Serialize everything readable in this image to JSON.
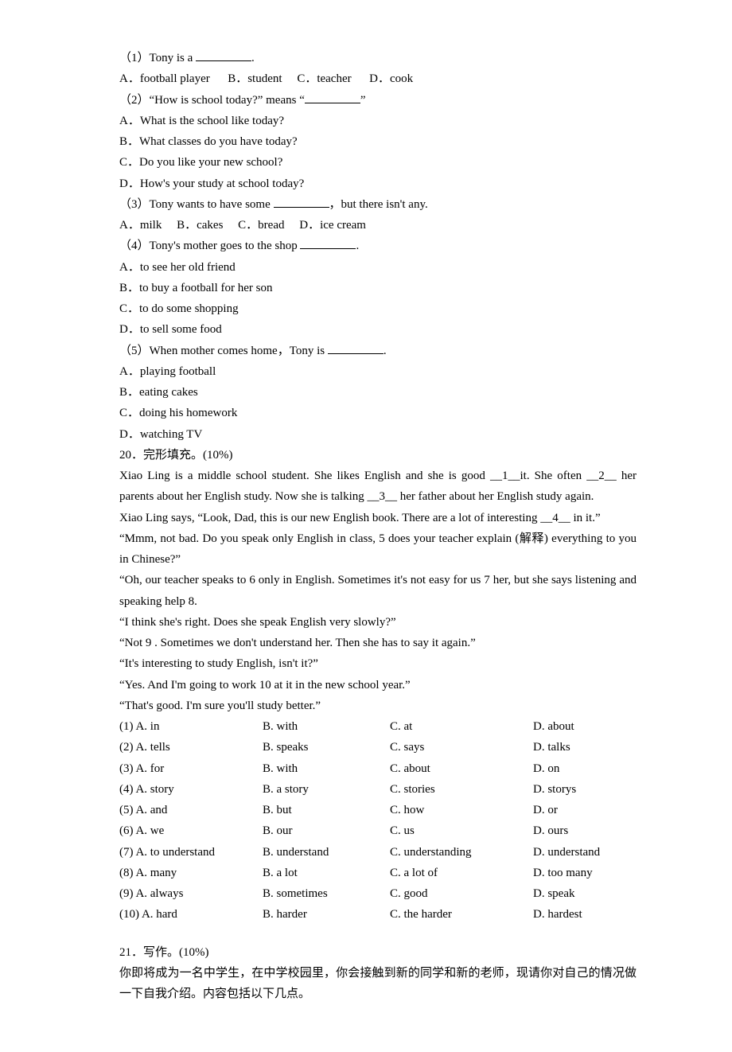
{
  "q19": {
    "q1": {
      "stem_pre": "（1）Tony is a ",
      "stem_post": "."
    },
    "q1opts": {
      "a": "A．football player",
      "b": "B．student",
      "c": "C．teacher",
      "d": "D．cook"
    },
    "q2": {
      "stem_pre": "（2）“How is school today?” means “",
      "stem_post": "”"
    },
    "q2opts": {
      "a": "A．What is the school like today?",
      "b": "B．What classes do you have today?",
      "c": "C．Do you like your new school?",
      "d": "D．How's your study at school today?"
    },
    "q3": {
      "stem_pre": "（3）Tony wants to have some ",
      "stem_post": "，but there isn't any."
    },
    "q3opts": {
      "a": "A．milk",
      "b": "B．cakes",
      "c": "C．bread",
      "d": "D．ice cream"
    },
    "q4": {
      "stem_pre": "（4）Tony's mother goes to the shop ",
      "stem_post": "."
    },
    "q4opts": {
      "a": "A．to see her old friend",
      "b": "B．to buy a football for her son",
      "c": "C．to do some shopping",
      "d": "D．to sell some food"
    },
    "q5": {
      "stem_pre": "（5）When mother comes home，Tony is ",
      "stem_post": "."
    },
    "q5opts": {
      "a": "A．playing football",
      "b": "B．eating cakes",
      "c": "C．doing his homework",
      "d": "D．watching TV"
    }
  },
  "q20": {
    "title": "20．完形填充。(10%)",
    "passage": [
      "Xiao Ling is a middle school student. She likes English and she is good __1__it. She often __2__ her parents about her English study. Now she is talking __3__ her father about her English study again.",
      " Xiao Ling says, “Look, Dad, this is our new English book. There are a lot of interesting __4__ in it.”",
      "“Mmm, not bad. Do you speak only English in class, 5 does your teacher explain (解释) everything to you in Chinese?”",
      "“Oh, our teacher speaks to 6 only in English. Sometimes it's not easy for us 7 her, but she says listening and speaking help 8.",
      "“I think she's right. Does she speak English very slowly?”",
      "“Not 9 . Sometimes we don't understand her. Then she has to say it again.”",
      "“It's interesting to study English, isn't it?”",
      "“Yes. And I'm going to work 10 at it in the new school year.”",
      "“That's good. I'm sure you'll study better.”"
    ],
    "opts": [
      {
        "label": "(1)",
        "a": "A. in",
        "b": "B. with",
        "c": "C. at",
        "d": "D. about"
      },
      {
        "label": "(2)",
        "a": "A. tells",
        "b": "B. speaks",
        "c": "C. says",
        "d": "D. talks"
      },
      {
        "label": "(3)",
        "a": "A. for",
        "b": "B. with",
        "c": "C. about",
        "d": "D. on"
      },
      {
        "label": "(4)",
        "a": "A. story",
        "b": "B. a story",
        "c": "C. stories",
        "d": "D. storys"
      },
      {
        "label": "(5)",
        "a": "A. and",
        "b": "B. but",
        "c": "C. how",
        "d": "D. or"
      },
      {
        "label": "(6)",
        "a": "A. we",
        "b": "B. our",
        "c": "C. us",
        "d": "D. ours"
      },
      {
        "label": "(7)",
        "a": "A. to understand",
        "b": "B. understand",
        "c": "C. understanding",
        "d": "D. understand"
      },
      {
        "label": "(8)",
        "a": "A. many",
        "b": "B. a lot",
        "c": "C. a lot of",
        "d": "D. too many"
      },
      {
        "label": "(9)",
        "a": "A. always",
        "b": "B. sometimes",
        "c": "C. good",
        "d": "D. speak"
      },
      {
        "label": "(10)",
        "a": "A. hard",
        "b": "B. harder",
        "c": "C. the harder",
        "d": "D. hardest"
      }
    ]
  },
  "q21": {
    "title": "21．写作。(10%)",
    "prompt": "你即将成为一名中学生，在中学校园里，你会接触到新的同学和新的老师，现请你对自己的情况做一下自我介绍。内容包括以下几点。"
  }
}
